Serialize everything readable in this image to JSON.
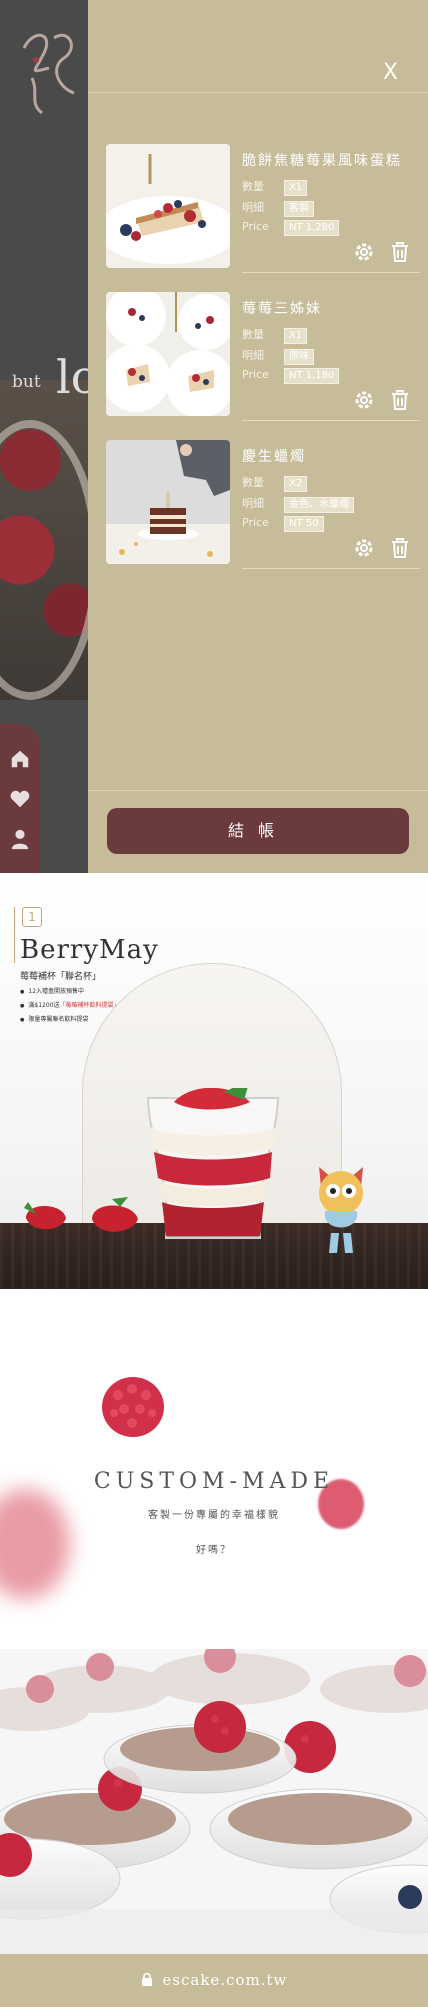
{
  "drawer": {
    "close_label": "X",
    "items": [
      {
        "name": "脆餅焦糖莓果風味蛋糕",
        "qty_label": "數量",
        "qty": "X1",
        "detail_label": "明細",
        "detail": "客製",
        "price_label": "Price",
        "price": "NT 1,280"
      },
      {
        "name": "莓莓三姊妹",
        "qty_label": "數量",
        "qty": "X1",
        "detail_label": "明細",
        "detail": "原味",
        "price_label": "Price",
        "price": "NT 1,180"
      },
      {
        "name": "慶生蠟燭",
        "qty_label": "數量",
        "qty": "X2",
        "detail_label": "明細",
        "detail": "金色、水蠟燭",
        "price_label": "Price",
        "price": "NT 50"
      }
    ],
    "checkout_label": "結帳"
  },
  "background": {
    "but_text": "but",
    "lo_text": "lo"
  },
  "berry": {
    "number": "1",
    "title": "BerryMay",
    "subtitle": "莓莓補杯「聯名杯」",
    "bullets": [
      {
        "pre": "12入禮盒開放預售中",
        "hl": "",
        "post": ""
      },
      {
        "pre": "滿$1200送",
        "hl": "「莓莓補杯飲料提袋」",
        "post": "乙天"
      },
      {
        "pre": "限量專屬聯名飲料提袋",
        "hl": "",
        "post": ""
      }
    ]
  },
  "custom": {
    "title": "CUSTOM-MADE",
    "subtitle": "客製一份專屬的幸福樣貌",
    "question": "好嗎？"
  },
  "footer": {
    "url": "escake.com.tw"
  },
  "colors": {
    "drawer_bg": "#c7bc9a",
    "accent_wine": "#6b3a3d",
    "footer_bg": "#c7bc9a"
  }
}
